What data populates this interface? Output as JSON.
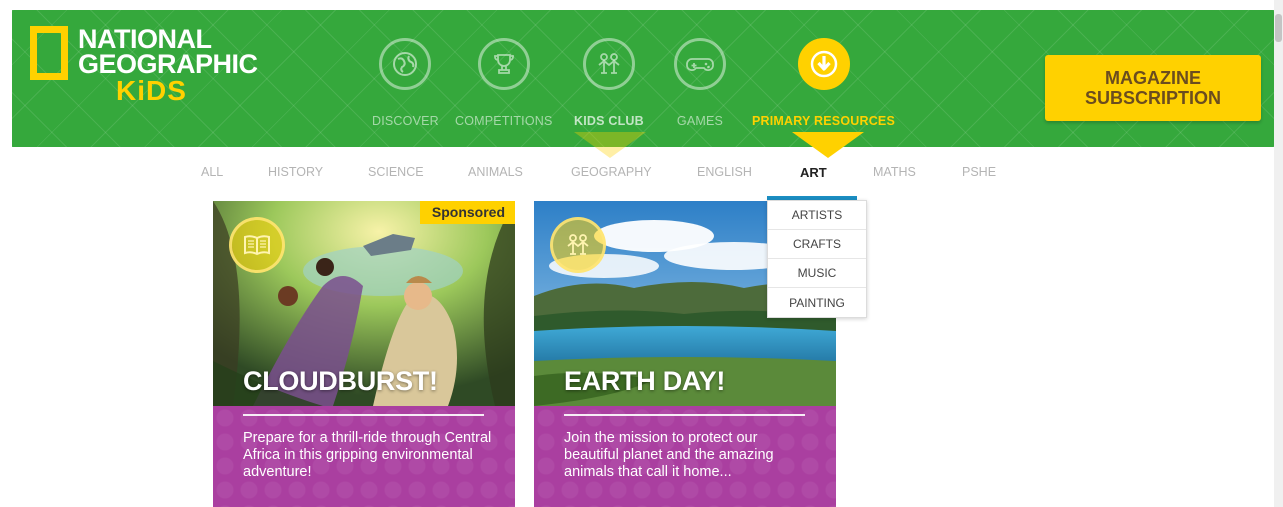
{
  "logo": {
    "line1": "NATIONAL",
    "line2": "GEOGRAPHIC",
    "line3": "KiDS"
  },
  "nav": {
    "items": [
      {
        "label": "DISCOVER",
        "icon": "globe-icon"
      },
      {
        "label": "COMPETITIONS",
        "icon": "trophy-icon"
      },
      {
        "label": "KIDS CLUB",
        "icon": "kids-club-icon"
      },
      {
        "label": "GAMES",
        "icon": "gamepad-icon"
      },
      {
        "label": "PRIMARY RESOURCES",
        "icon": "download-arrow-icon",
        "active": true
      }
    ]
  },
  "subscription": {
    "line1": "MAGAZINE",
    "line2": "SUBSCRIPTION"
  },
  "subnav": {
    "items": [
      "ALL",
      "HISTORY",
      "SCIENCE",
      "ANIMALS",
      "GEOGRAPHY",
      "ENGLISH",
      "ART",
      "MATHS",
      "PSHE"
    ],
    "active": "ART"
  },
  "dropdown": {
    "items": [
      "ARTISTS",
      "CRAFTS",
      "MUSIC",
      "PAINTING"
    ]
  },
  "cards": [
    {
      "title": "CLOUDBURST!",
      "badge": "Sponsored",
      "icon": "book-icon",
      "description": "Prepare for a thrill-ride through Central Africa in this gripping environmental adventure!"
    },
    {
      "title": "EARTH DAY!",
      "icon": "kids-club-icon",
      "description": "Join the mission to protect our beautiful planet and the amazing animals that call it home..."
    }
  ],
  "colors": {
    "header_green": "#35a83c",
    "accent_yellow": "#ffd100",
    "card_purple": "#aa3fa0",
    "active_underline": "#1b8ec2"
  }
}
